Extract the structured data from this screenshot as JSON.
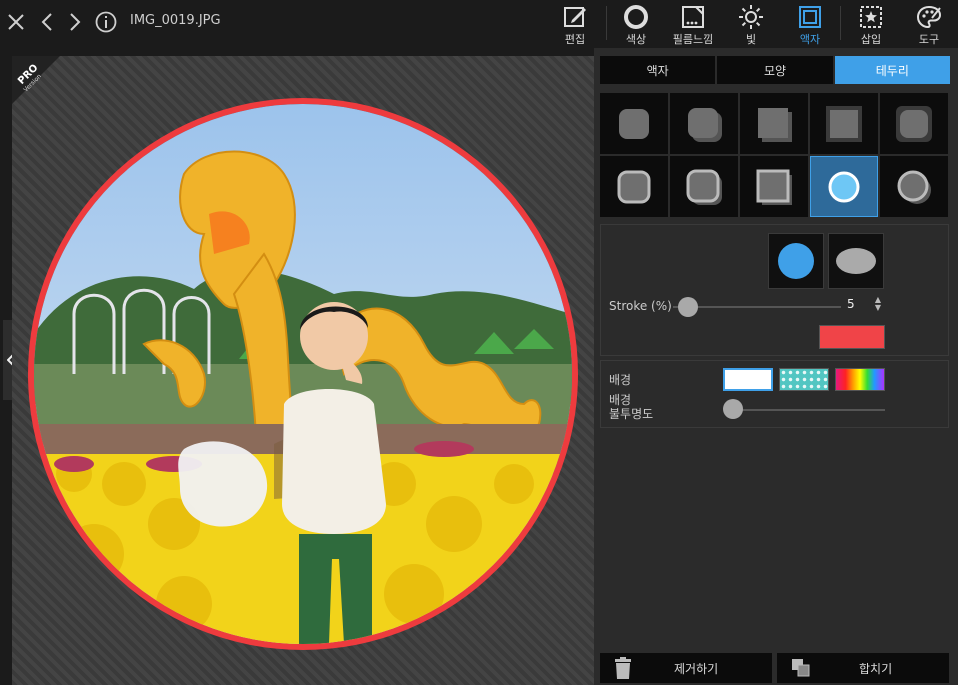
{
  "file": {
    "name": "IMG_0019.JPG"
  },
  "toolbar": {
    "tools": [
      {
        "label": "편집",
        "icon": "edit-icon"
      },
      {
        "label": "색상",
        "icon": "color-circle-icon"
      },
      {
        "label": "필름느낌",
        "icon": "film-icon"
      },
      {
        "label": "빛",
        "icon": "sun-icon"
      },
      {
        "label": "액자",
        "icon": "frame-icon",
        "active": true
      },
      {
        "label": "삽입",
        "icon": "insert-star-icon"
      },
      {
        "label": "도구",
        "icon": "palette-icon"
      }
    ]
  },
  "badge": {
    "text": "PRO",
    "subtext": "Version"
  },
  "panel": {
    "tabs": [
      {
        "label": "액자"
      },
      {
        "label": "모양"
      },
      {
        "label": "테두리",
        "active": true
      }
    ],
    "stroke_label": "Stroke (%)",
    "stroke_value": "5",
    "stroke_fraction": 0.03,
    "stroke_color": "#f04448",
    "background_label": "배경",
    "opacity_label_line1": "배경",
    "opacity_label_line2": "불투명도",
    "opacity_fraction": 0.0,
    "remove_label": "제거하기",
    "merge_label": "합치기"
  },
  "colors": {
    "accent": "#3fa0e8",
    "frame_border": "#ee3b3e"
  }
}
